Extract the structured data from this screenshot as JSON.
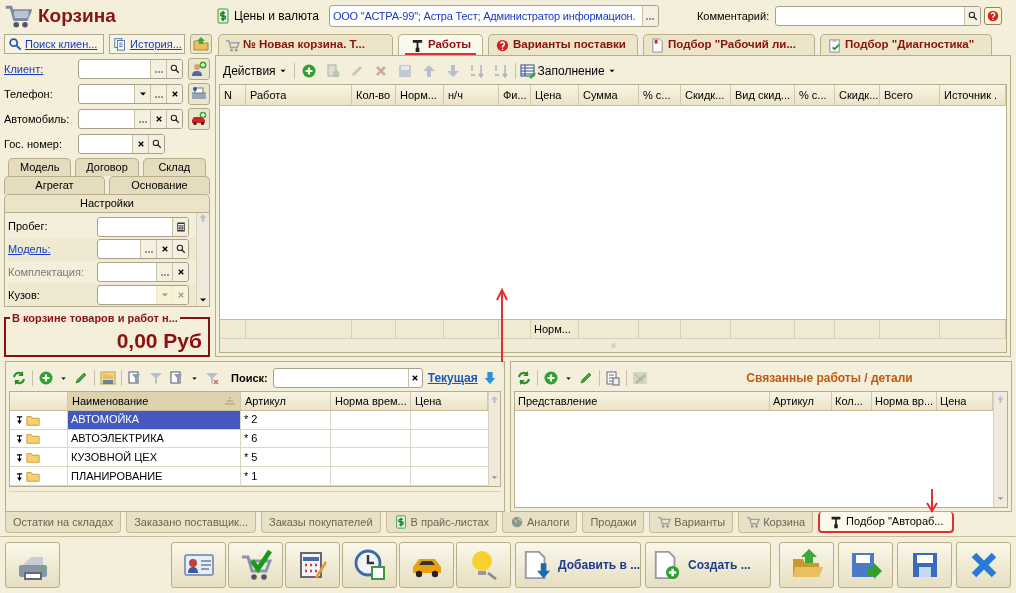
{
  "window": {
    "title": "Корзина"
  },
  "header": {
    "prices_button": "Цены и валюта",
    "organization": "ООО \"АСТРА-99\"; Астра Тест; Администратор информацион.",
    "comment_label": "Комментарий:"
  },
  "client_panel": {
    "buttons": [
      "Поиск клиен...",
      "История..."
    ],
    "fields": [
      {
        "label": "Клиент:",
        "link": true,
        "controls": [
          {
            "kind": "select"
          },
          {
            "kind": "search"
          }
        ]
      },
      {
        "label": "Телефон:",
        "link": false,
        "controls": [
          {
            "kind": "dropdown"
          },
          {
            "kind": "select"
          },
          {
            "kind": "clear"
          }
        ]
      },
      {
        "label": "Автомобиль:",
        "link": false,
        "controls": [
          {
            "kind": "select"
          },
          {
            "kind": "clear"
          },
          {
            "kind": "search"
          }
        ]
      },
      {
        "label": "Гос. номер:",
        "link": false,
        "controls": [
          {
            "kind": "clear"
          },
          {
            "kind": "search"
          }
        ]
      }
    ],
    "tab_rows": [
      [
        {
          "label": "Модель",
          "selected": false
        },
        {
          "label": "Договор",
          "selected": false
        },
        {
          "label": "Склад",
          "selected": false
        }
      ],
      [
        {
          "label": "Агрегат",
          "selected": false
        },
        {
          "label": "Основание",
          "selected": false
        }
      ],
      [
        {
          "label": "Настройки",
          "selected": true
        }
      ]
    ],
    "settings": [
      {
        "label": "Пробег:",
        "link": false,
        "disabled": false,
        "controls": [
          {
            "kind": "calculator",
            "disabled": false
          }
        ]
      },
      {
        "label": "Модель:",
        "link": true,
        "disabled": false,
        "controls": [
          {
            "kind": "select",
            "disabled": false
          },
          {
            "kind": "clear",
            "disabled": false
          },
          {
            "kind": "search",
            "disabled": false
          }
        ]
      },
      {
        "label": "Комплектация:",
        "link": false,
        "disabled": true,
        "controls": [
          {
            "kind": "select",
            "disabled": false
          },
          {
            "kind": "clear",
            "disabled": false
          }
        ]
      },
      {
        "label": "Кузов:",
        "link": false,
        "disabled": false,
        "controls": [
          {
            "kind": "dropdown",
            "disabled": true
          },
          {
            "kind": "clear",
            "disabled": true
          }
        ]
      }
    ],
    "total": {
      "label": "В корзине товаров и работ н...",
      "value": "0,00 Руб"
    }
  },
  "tabs": [
    {
      "label": "№ Новая корзина. Т...",
      "selected": false
    },
    {
      "label": "Работы",
      "selected": true
    },
    {
      "label": "Варианты поставки",
      "selected": false
    },
    {
      "label": "Подбор \"Рабочий ли...",
      "selected": false
    },
    {
      "label": "Подбор \"Диагностика\"",
      "selected": false
    }
  ],
  "works": {
    "toolbar": {
      "actions": "Действия",
      "fill": "Заполнение"
    },
    "columns": [
      {
        "label": "N"
      },
      {
        "label": "Работа"
      },
      {
        "label": "Кол-во"
      },
      {
        "label": "Норм..."
      },
      {
        "label": "н/ч"
      },
      {
        "label": "Фи..."
      },
      {
        "label": "Цена",
        "footer": "Норм..."
      },
      {
        "label": "Сумма"
      },
      {
        "label": "% с..."
      },
      {
        "label": "Скидк..."
      },
      {
        "label": "Вид скид..."
      },
      {
        "label": "% с..."
      },
      {
        "label": "Скидк..."
      },
      {
        "label": "Всего"
      },
      {
        "label": "Источник ."
      }
    ]
  },
  "catalog": {
    "search_label": "Поиск:",
    "current_link": "Текущая",
    "columns": [
      {
        "label": "Наименование",
        "sorted": true
      },
      {
        "label": "Артикул",
        "sorted": false
      },
      {
        "label": "Норма врем...",
        "sorted": false
      },
      {
        "label": "Цена",
        "sorted": false
      }
    ],
    "rows": [
      {
        "name": "АВТОМОЙКА",
        "article": "* 2",
        "selected": true
      },
      {
        "name": "АВТОЭЛЕКТРИКА",
        "article": "* 6",
        "selected": false
      },
      {
        "name": "КУЗОВНОЙ ЦЕХ",
        "article": "* 5",
        "selected": false
      },
      {
        "name": "ПЛАНИРОВАНИЕ",
        "article": "* 1",
        "selected": false
      }
    ]
  },
  "related": {
    "title": "Связанные работы / детали",
    "columns": [
      {
        "label": "Представление"
      },
      {
        "label": "Артикул"
      },
      {
        "label": "Кол..."
      },
      {
        "label": "Норма вр..."
      },
      {
        "label": "Цена"
      }
    ]
  },
  "bottom_tabs": [
    {
      "label": "Остатки на складах",
      "selected": false,
      "highlighted": false
    },
    {
      "label": "Заказано поставщик...",
      "selected": false,
      "highlighted": false
    },
    {
      "label": "Заказы покупателей",
      "selected": false,
      "highlighted": false
    },
    {
      "label": "В прайс-листах",
      "selected": false,
      "highlighted": false
    },
    {
      "label": "Аналоги",
      "selected": false,
      "highlighted": false
    },
    {
      "label": "Продажи",
      "selected": false,
      "highlighted": false
    },
    {
      "label": "Варианты",
      "selected": false,
      "highlighted": false
    },
    {
      "label": "Корзина",
      "selected": false,
      "highlighted": false
    },
    {
      "label": "Подбор \"Автораб...",
      "selected": true,
      "highlighted": true
    }
  ],
  "bottom_toolbar": {
    "buttons": [
      "Добавить в ...",
      "Создать ..."
    ]
  }
}
